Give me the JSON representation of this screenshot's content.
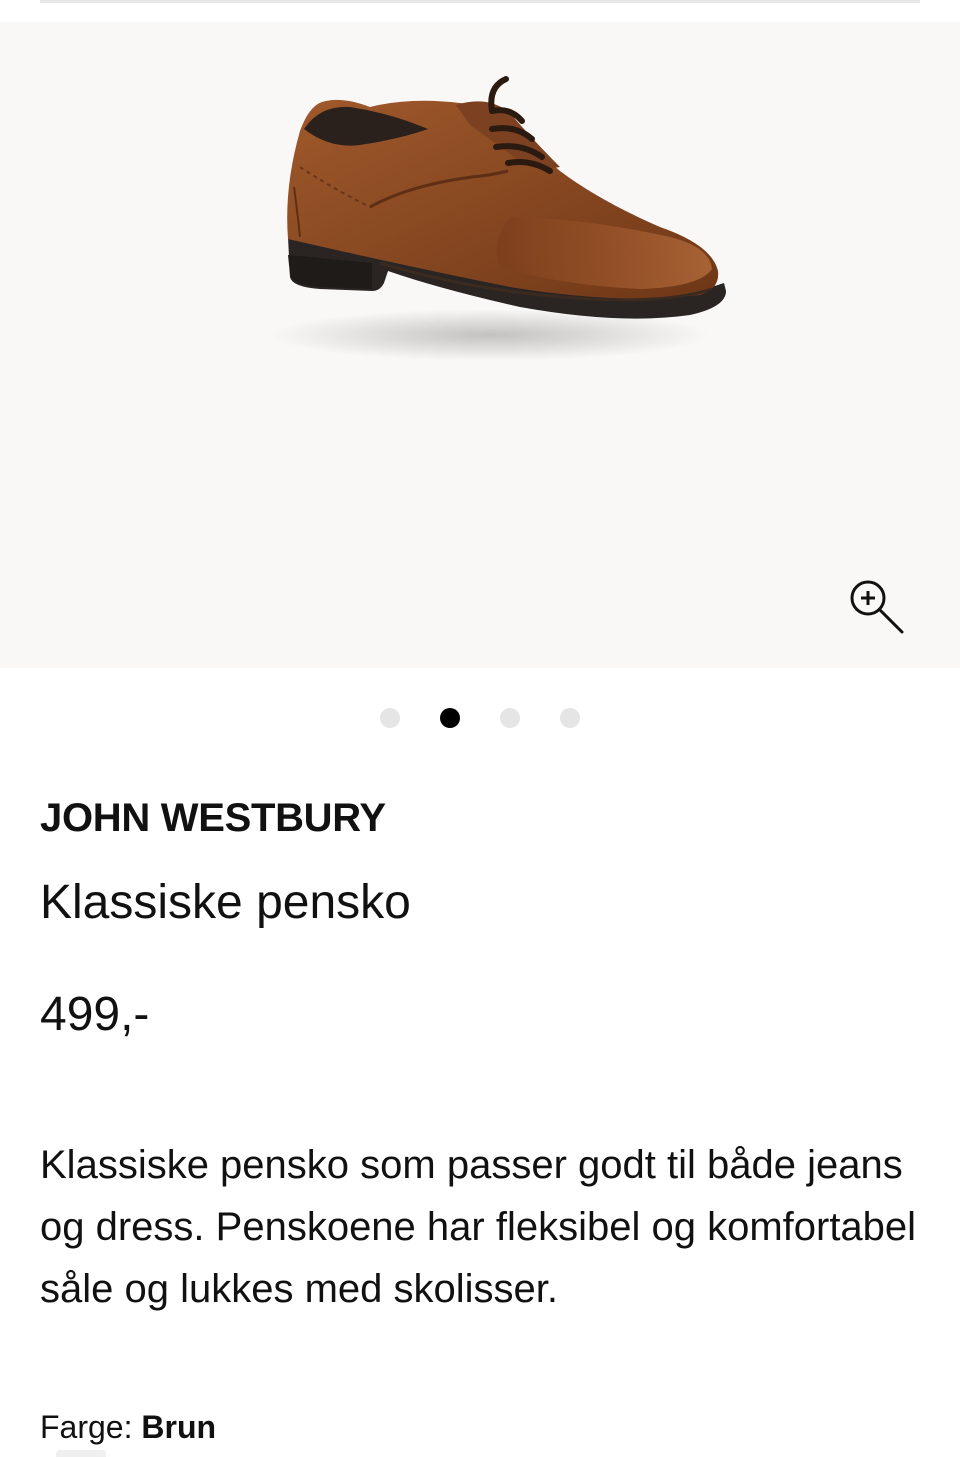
{
  "gallery": {
    "image_alt": "Klassiske pensko",
    "slide_count": 4,
    "active_slide": 2,
    "zoom_icon": "zoom-in-icon"
  },
  "product": {
    "brand": "JOHN WESTBURY",
    "name": "Klassiske pensko",
    "price": "499,-",
    "description": "Klassiske pensko som passer godt til både jeans og dress. Penskoene har fleksibel og komfortabel såle og lukkes med skolisser.",
    "color_label": "Farge:",
    "color_value": "Brun"
  },
  "colors": {
    "background": "#ffffff",
    "gallery_background": "#faf8f6",
    "text": "#111111",
    "dot_active": "#000000",
    "dot_inactive": "#e5e5e5",
    "shoe_leather": "#8a4a22"
  }
}
